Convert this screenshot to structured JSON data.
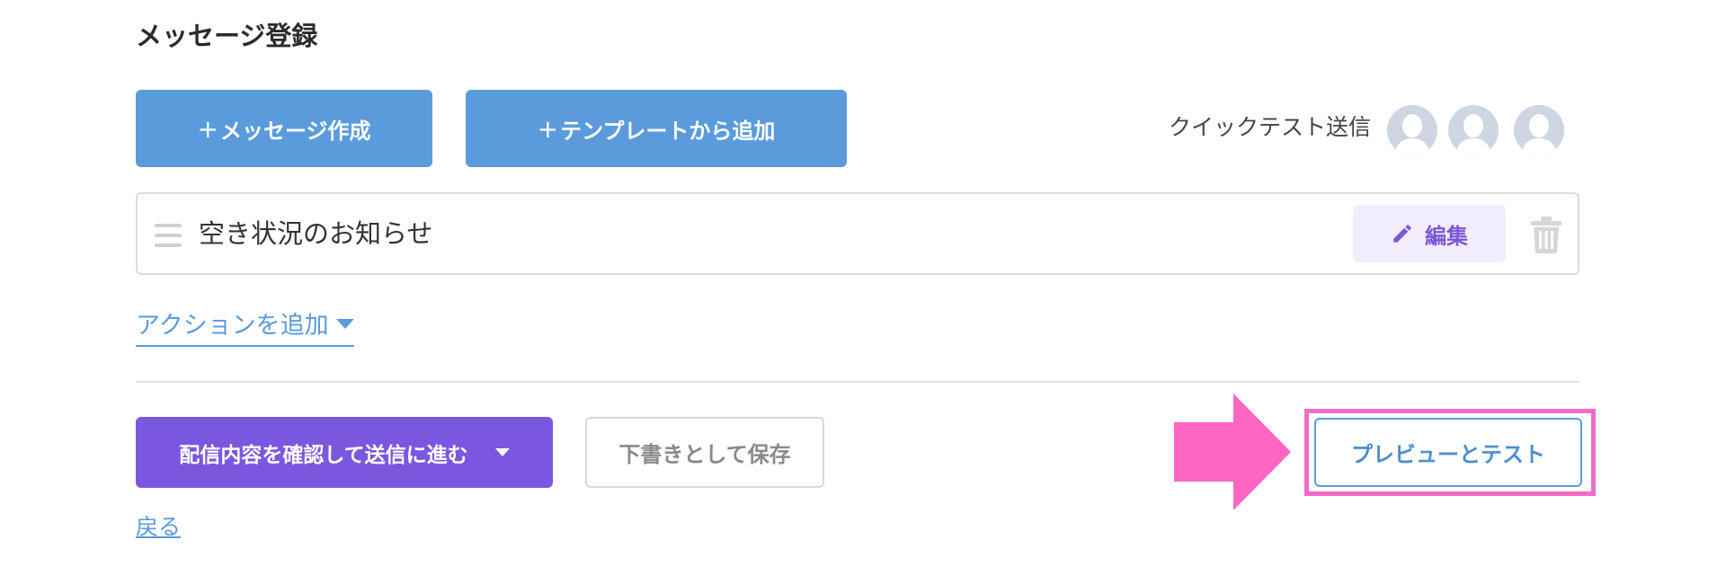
{
  "section": {
    "title": "メッセージ登録"
  },
  "toolbar": {
    "create_plus": "+",
    "create_label": "メッセージ作成",
    "template_plus": "+",
    "template_label": "テンプレートから追加"
  },
  "quick_test": {
    "label": "クイックテスト送信",
    "avatars": [
      "user-avatar",
      "user-avatar",
      "user-avatar"
    ]
  },
  "message_item": {
    "name": "空き状況のお知らせ",
    "edit_label": "編集",
    "icons": [
      "drag-handle-icon",
      "pencil-icon",
      "trash-icon"
    ]
  },
  "add_action": {
    "label": "アクションを追加"
  },
  "footer": {
    "submit_label": "配信内容を確認して送信に進む",
    "draft_label": "下書きとして保存",
    "preview_label": "プレビューとテスト",
    "back_label": "戻る"
  },
  "colors": {
    "primary_blue": "#5b9bdc",
    "primary_purple": "#7b57e0",
    "edit_bg": "#f1edfd",
    "highlight_pink": "#f26bc7",
    "avatar_bg": "#cfd6e3"
  }
}
